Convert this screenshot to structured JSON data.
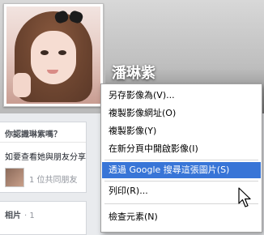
{
  "profile": {
    "name": "潘琳紫"
  },
  "sidebar": {
    "know_card": {
      "title": "你認識琳紫嗎？",
      "description": "如要查看她與朋友分享",
      "mutual_friends": "1 位共同朋友"
    },
    "photos_card": {
      "title": "相片",
      "count": "· 1"
    }
  },
  "context_menu": {
    "items": [
      {
        "label": "另存影像為(V)..."
      },
      {
        "label": "複製影像網址(O)"
      },
      {
        "label": "複製影像(Y)"
      },
      {
        "label": "在新分頁中開啟影像(I)"
      },
      {
        "label": "透過 Google 搜尋這張圖片(S)",
        "highlighted": true
      },
      {
        "label": "列印(R)..."
      },
      {
        "label": "檢查元素(N)"
      }
    ]
  },
  "colors": {
    "highlight": "#3875d7",
    "page_background": "#e9ebee"
  },
  "icons": {
    "cursor": "cursor-arrow-icon"
  }
}
